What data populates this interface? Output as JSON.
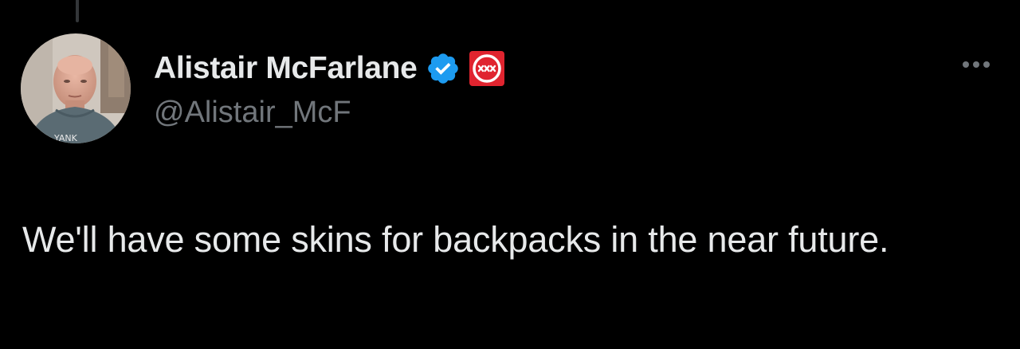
{
  "tweet": {
    "author": {
      "display_name": "Alistair McFarlane",
      "handle": "@Alistair_McF",
      "avatar_icon": "profile-photo",
      "verified_icon": "verified-checkmark-icon",
      "verified_color": "#1d9bf0",
      "affiliate_badge_icon": "affiliate-badge-icon",
      "affiliate_badge_color": "#e0242f"
    },
    "text": "We'll have some skins for backpacks in the near future.",
    "more_icon": "more-horizontal-icon"
  },
  "colors": {
    "background": "#000000",
    "primary_text": "#e7e9ea",
    "secondary_text": "#71767b"
  }
}
